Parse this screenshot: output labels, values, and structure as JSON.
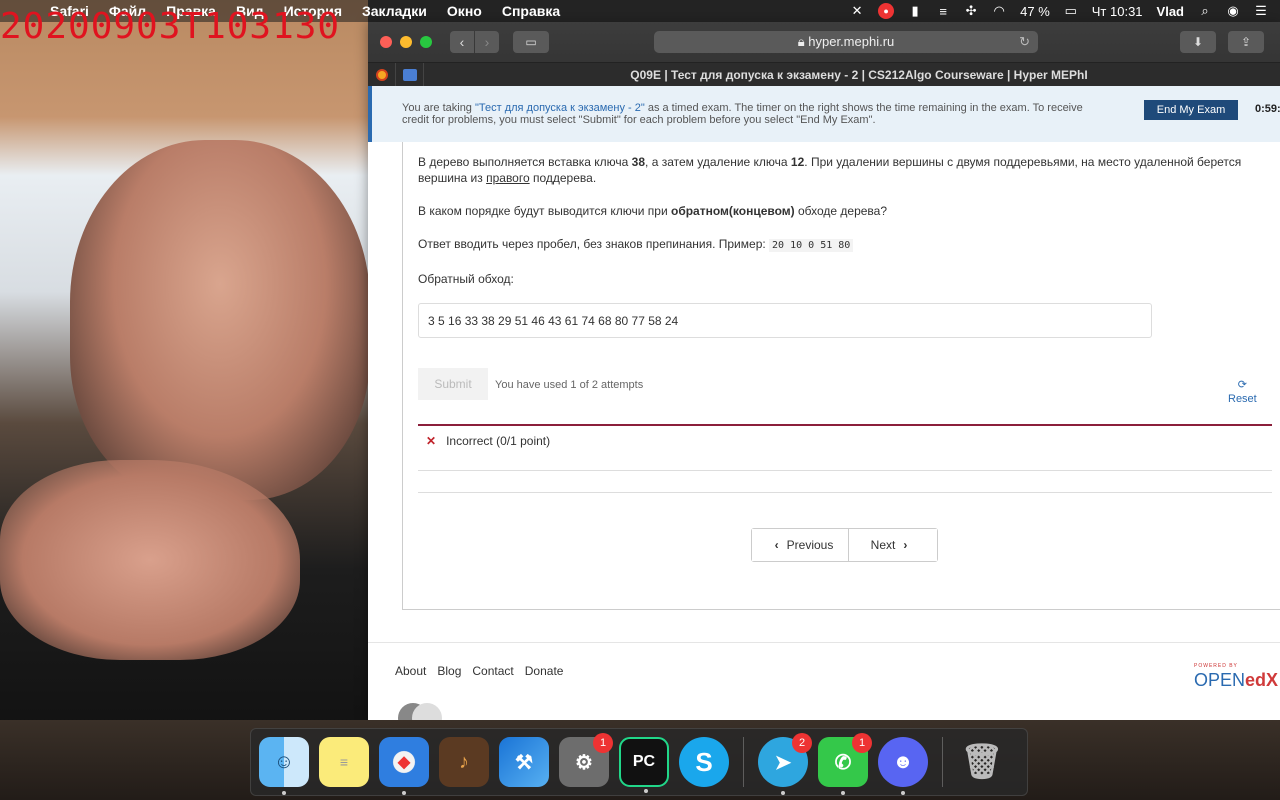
{
  "watermark": "20200903T103130",
  "menubar": {
    "apple": "",
    "items": [
      "Safari",
      "Файл",
      "Правка",
      "Вид",
      "История",
      "Закладки",
      "Окно",
      "Справка"
    ],
    "battery": "47 %",
    "clock": "Чт 10:31",
    "user": "Vlad"
  },
  "browser": {
    "url": "hyper.mephi.ru",
    "tab_title": "Q09E | Тест для допуска к экзамену - 2 | CS212Algo Courseware | Hyper MEPhI"
  },
  "exam": {
    "msg_prefix": "You are taking ",
    "exam_name": "\"Тест для допуска к экзамену - 2\"",
    "msg_suffix": " as a timed exam. The timer on the right shows the time remaining in the exam. To receive credit for problems, you must select \"Submit\" for each problem before you select \"End My Exam\".",
    "end_button": "End My Exam",
    "timer": "0:59:"
  },
  "problem": {
    "p1_a": "В дерево выполняется вставка ключа ",
    "p1_b": "38",
    "p1_c": ", а затем удаление ключа ",
    "p1_d": "12",
    "p1_e": ". При удалении вершины с двумя поддеревьями, на место удаленной берется вершина из ",
    "p1_f": "правого",
    "p1_g": " поддерева.",
    "p2_a": "В каком порядке будут выводится ключи при ",
    "p2_b": "обратном(концевом)",
    "p2_c": " обходе дерева?",
    "p3_a": "Ответ вводить через пробел, без знаков препинания. Пример: ",
    "p3_code": "20 10 0 51 80",
    "p4": "Обратный обход:",
    "answer_value": "3 5 16 33 38 29 51 46 43 61 74 68 80 77 58 24",
    "submit_label": "Submit",
    "attempts": "You have used 1 of 2 attempts",
    "reset_label": "Reset",
    "result": "Incorrect (0/1 point)"
  },
  "pager": {
    "previous": "Previous",
    "next": "Next"
  },
  "footer": {
    "links": [
      "About",
      "Blog",
      "Contact",
      "Donate"
    ],
    "logo_small": "POWERED BY",
    "logo_open": "OPEN",
    "logo_edx": "edX"
  },
  "dock": {
    "telegram_badge": "2",
    "facetime_badge": "1",
    "prefs_badge": "1",
    "pycharm_label": "PC"
  },
  "colors": {
    "accent": "#2a6ab0",
    "incorrect": "#c0232b",
    "divider": "#8b1f3b"
  }
}
